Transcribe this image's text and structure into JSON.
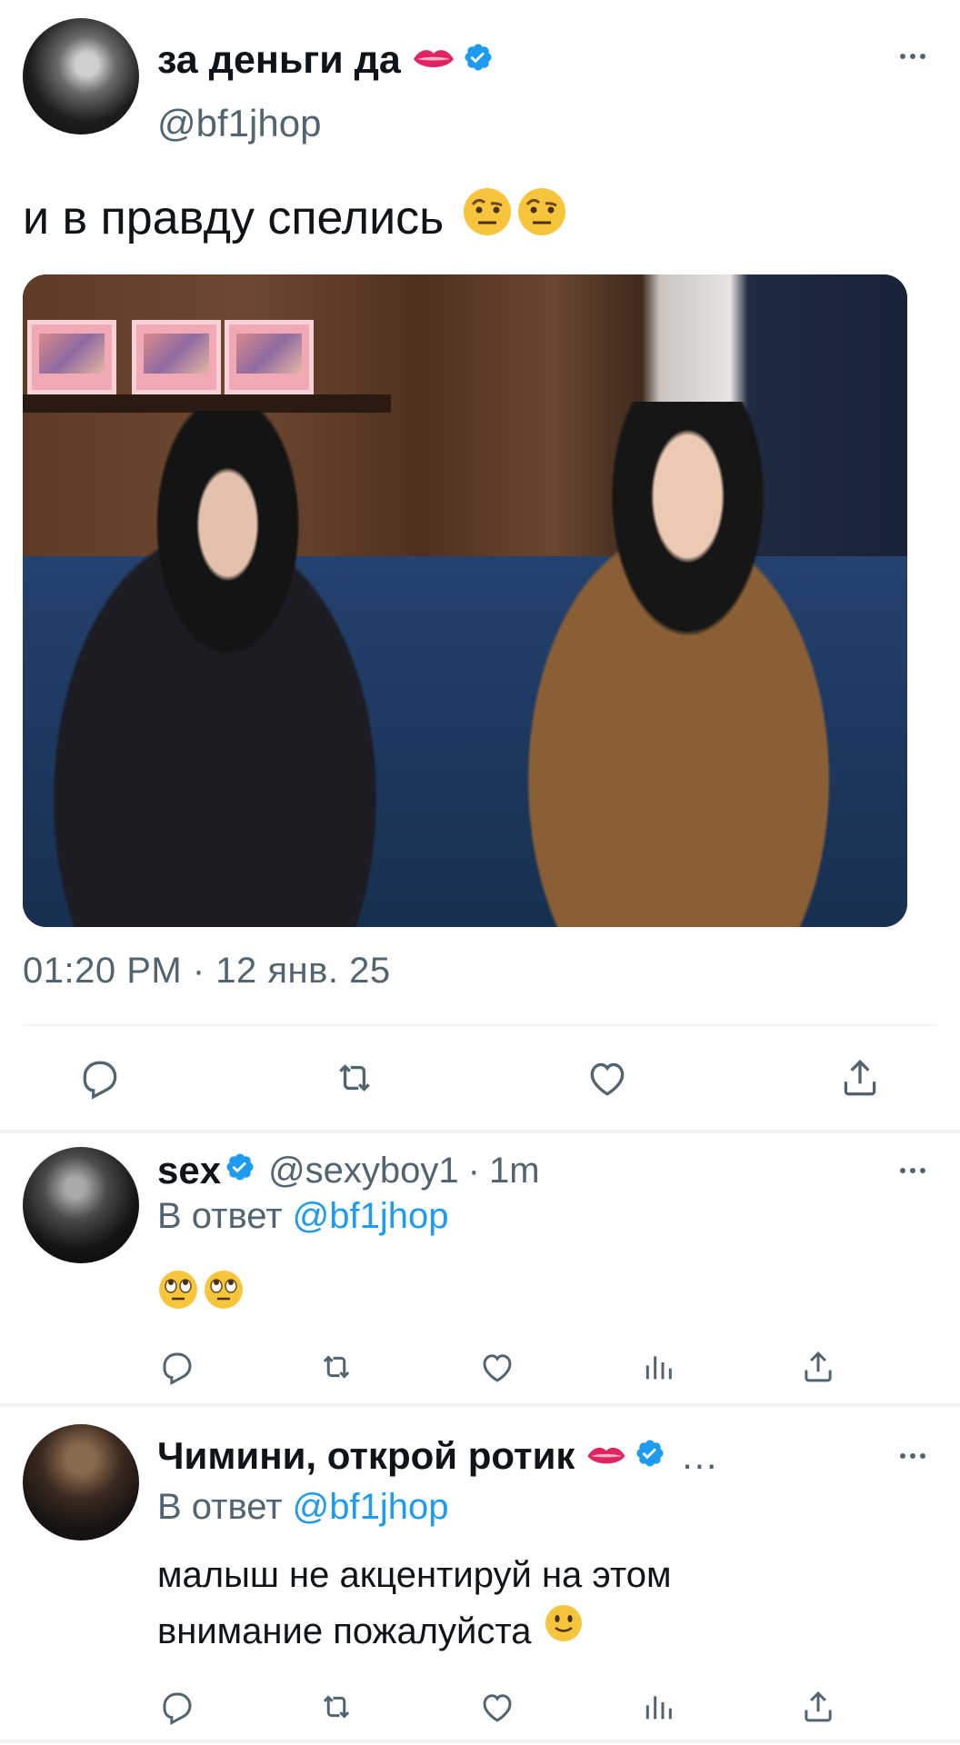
{
  "main_tweet": {
    "display_name": "за деньги да",
    "name_emoji": "lips-icon",
    "verified": true,
    "handle": "@bf1jhop",
    "text": "и в правду спелись",
    "text_emojis": [
      "face-with-raised-eyebrow-icon",
      "face-with-raised-eyebrow-icon"
    ],
    "timestamp": "01:20 PM · 12 янв. 25"
  },
  "replies": [
    {
      "display_name": "sex",
      "verified": true,
      "handle": "@sexyboy1",
      "dot": "·",
      "age": "1m",
      "reply_prefix": "В ответ",
      "reply_to": "@bf1jhop",
      "text_emojis": [
        "face-with-rolling-eyes-icon",
        "face-with-rolling-eyes-icon"
      ]
    },
    {
      "display_name": "Чимини, открой ротик",
      "name_emoji": "lips-icon",
      "verified": true,
      "ellipsis": "…",
      "reply_prefix": "В ответ",
      "reply_to": "@bf1jhop",
      "text_line1": "малыш не акцентируй на этом",
      "text_line2": "внимание пожалуйста",
      "text_emoji": "slightly-smiling-face-icon"
    }
  ],
  "colors": {
    "text": "#0f1419",
    "secondary": "#536471",
    "accent": "#1d9bf0",
    "divider": "#eff3f4"
  }
}
